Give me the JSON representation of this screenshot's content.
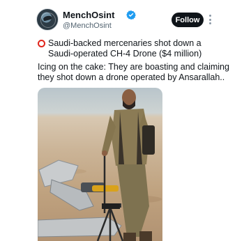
{
  "author": {
    "display_name": "MenchOsint",
    "handle": "@MenchOsint",
    "verified": true,
    "avatar_icon": "globe-avatar-icon"
  },
  "actions": {
    "follow_label": "Follow",
    "more_icon": "more-dots-icon"
  },
  "tweet": {
    "headline_icon": "red-circle-icon",
    "headline_lines": [
      "Saudi-backed mercenaries shot down a",
      "Saudi-operated CH-4 Drone ($4 million)"
    ],
    "body_lines": [
      "Icing on the cake: They are boasting and claiming",
      "they shot down a drone operated by Ansarallah.."
    ]
  },
  "colors": {
    "text": "#0f1419",
    "secondary_text": "#536471",
    "verified_badge": "#1d9bf0",
    "follow_button": "#0f1419",
    "red_circle": "#e0251b"
  }
}
